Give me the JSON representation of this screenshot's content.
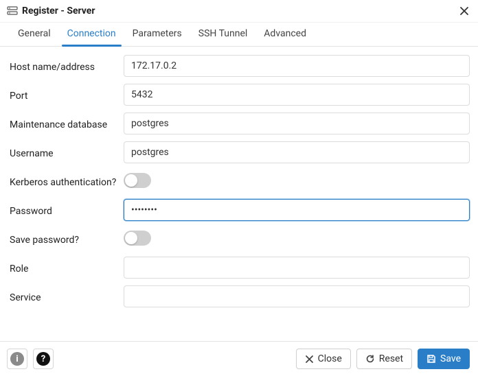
{
  "title": "Register - Server",
  "tabs": [
    {
      "label": "General"
    },
    {
      "label": "Connection"
    },
    {
      "label": "Parameters"
    },
    {
      "label": "SSH Tunnel"
    },
    {
      "label": "Advanced"
    }
  ],
  "fields": {
    "host": {
      "label": "Host name/address",
      "value": "172.17.0.2"
    },
    "port": {
      "label": "Port",
      "value": "5432"
    },
    "maintenance_db": {
      "label": "Maintenance database",
      "value": "postgres"
    },
    "username": {
      "label": "Username",
      "value": "postgres"
    },
    "kerberos": {
      "label": "Kerberos authentication?",
      "on": false
    },
    "password": {
      "label": "Password",
      "value": "••••••••"
    },
    "save_password": {
      "label": "Save password?",
      "on": false
    },
    "role": {
      "label": "Role",
      "value": ""
    },
    "service": {
      "label": "Service",
      "value": ""
    }
  },
  "footer": {
    "close": "Close",
    "reset": "Reset",
    "save": "Save"
  }
}
